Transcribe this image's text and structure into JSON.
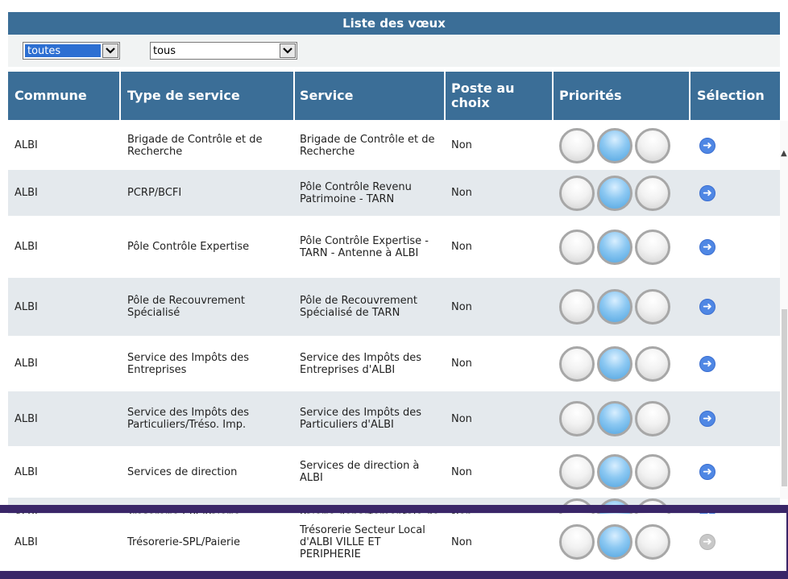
{
  "title": "Liste des vœux",
  "filters": {
    "commune_value": "toutes",
    "type_value": "tous"
  },
  "headers": {
    "commune": "Commune",
    "type": "Type de service",
    "service": "Service",
    "poste": "Poste au choix",
    "priorites": "Priorités",
    "selection": "Sélection"
  },
  "rows": [
    {
      "commune": "ALBI",
      "type": "Brigade de Contrôle et de Recherche",
      "service": "Brigade de Contrôle et de Recherche",
      "poste": "Non",
      "priority_selected": 2,
      "selection_enabled": true
    },
    {
      "commune": "ALBI",
      "type": "PCRP/BCFI",
      "service": "Pôle Contrôle Revenu Patrimoine - TARN",
      "poste": "Non",
      "priority_selected": 2,
      "selection_enabled": true
    },
    {
      "commune": "ALBI",
      "type": "Pôle Contrôle Expertise",
      "service": "Pôle Contrôle Expertise - TARN - Antenne à ALBI",
      "poste": "Non",
      "priority_selected": 2,
      "selection_enabled": true
    },
    {
      "commune": "ALBI",
      "type": "Pôle de Recouvrement Spécialisé",
      "service": "Pôle de Recouvrement Spécialisé de TARN",
      "poste": "Non",
      "priority_selected": 2,
      "selection_enabled": true
    },
    {
      "commune": "ALBI",
      "type": "Service des Impôts des Entreprises",
      "service": "Service des Impôts des Entreprises d'ALBI",
      "poste": "Non",
      "priority_selected": 2,
      "selection_enabled": true
    },
    {
      "commune": "ALBI",
      "type": "Service des Impôts des Particuliers/Tréso. Imp.",
      "service": "Service des Impôts des Particuliers d'ALBI",
      "poste": "Non",
      "priority_selected": 2,
      "selection_enabled": true
    },
    {
      "commune": "ALBI",
      "type": "Services de direction",
      "service": "Services de direction à ALBI",
      "poste": "Non",
      "priority_selected": 2,
      "selection_enabled": true
    },
    {
      "commune": "ALBI",
      "type": "Trésorerie-SPL/Paierie",
      "service": "Paierie départementale de",
      "poste": "Non",
      "priority_selected": 2,
      "selection_enabled": true
    },
    {
      "commune": "ALBI",
      "type": "Trésorerie-SPL/Paierie",
      "service": "Trésorerie Secteur Local d'ALBI VILLE ET PERIPHERIE",
      "poste": "Non",
      "priority_selected": 2,
      "selection_enabled": false
    }
  ],
  "colors": {
    "header": "#3b6e97",
    "row_alt": "#e4e9ed",
    "divider": "#3a2668",
    "go_icon": "#4f87e4"
  },
  "icons": {
    "priority": "priority-circle-icon",
    "select": "arrow-right-circle-icon"
  }
}
